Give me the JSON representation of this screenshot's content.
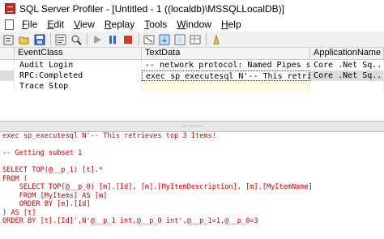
{
  "window": {
    "title": "SQL Server Profiler - [Untitled - 1 ((localdb)\\MSSQLLocalDB)]"
  },
  "menu": {
    "items": [
      "File",
      "Edit",
      "View",
      "Replay",
      "Tools",
      "Window",
      "Help"
    ],
    "mnemonics": [
      "F",
      "E",
      "V",
      "R",
      "T",
      "W",
      "H"
    ]
  },
  "toolbar": {
    "icons": [
      "new-trace-icon",
      "open-icon",
      "save-icon",
      "properties-icon",
      "find-icon",
      "start-icon",
      "pause-icon",
      "stop-icon",
      "clear-icon",
      "scroll-icon",
      "filter-icon",
      "grid-icon",
      "help-icon"
    ]
  },
  "grid": {
    "headers": [
      "EventClass",
      "TextData",
      "ApplicationName"
    ],
    "rows": [
      {
        "event": "Audit Login",
        "text": "-- network protocol: Named Pipes  set q",
        "app": "Core .Net Sq..."
      },
      {
        "event": "RPC:Completed",
        "text": "exec sp_executesql N'-- This retrieves ...",
        "app": "Core .Net Sq..."
      },
      {
        "event": "Trace Stop",
        "text": "",
        "app": ""
      }
    ]
  },
  "detail": {
    "lines": [
      "exec sp_executesql N'-- This retrieves top 3 Items!",
      "",
      "-- Getting subset 1",
      "",
      "SELECT TOP(@__p_1) [t].*",
      "FROM (",
      "    SELECT TOP(@__p_0) [m].[Id], [m].[MyItemDescription], [m].[MyItemName]",
      "    FROM [MyItems] AS [m]",
      "    ORDER BY [m].[Id]",
      ") AS [t]",
      "ORDER BY [t].[Id]',N'@__p_1 int,@__p_0 int',@__p_1=1,@__p_0=3"
    ]
  },
  "colors": {
    "sql_red": "#cc0000",
    "selected_row": "#dcdcdc",
    "toolbar_bg": "#f0f0f0"
  }
}
